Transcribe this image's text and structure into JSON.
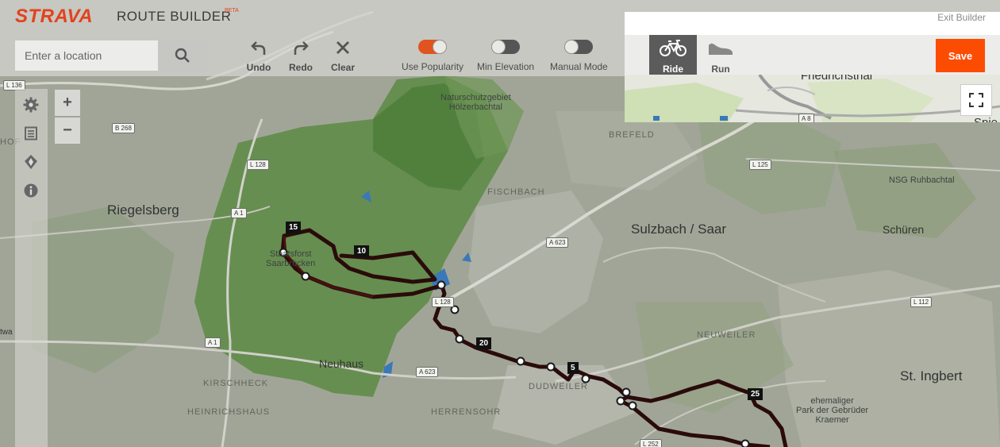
{
  "app": {
    "brand": "STRAVA",
    "title": "ROUTE BUILDER",
    "badge": "BETA"
  },
  "search": {
    "placeholder": "Enter a location",
    "value": ""
  },
  "toolbar": {
    "undo": "Undo",
    "redo": "Redo",
    "clear": "Clear"
  },
  "toggles": {
    "popularity": {
      "label": "Use Popularity",
      "on": true
    },
    "min_elevation": {
      "label": "Min Elevation",
      "on": false
    },
    "manual_mode": {
      "label": "Manual Mode",
      "on": false
    }
  },
  "panel": {
    "exit": "Exit Builder",
    "modes": {
      "ride": "Ride",
      "run": "Run"
    },
    "selected_mode": "ride",
    "save": "Save",
    "minimap_labels": {
      "town": "Friedrichsthal",
      "road": "A 8",
      "edge": "Spie"
    }
  },
  "sidebar_icons": [
    "gear-icon",
    "document-icon",
    "location-pin-icon",
    "info-icon"
  ],
  "zoom": {
    "in": "+",
    "out": "−"
  },
  "map": {
    "towns": {
      "riegelsberg": "Riegelsberg",
      "sulzbach": "Sulzbach / Saar",
      "schuren": "Schüren",
      "neuhaus": "Neuhaus",
      "ingbert": "St. Ingbert"
    },
    "areas": {
      "nsg_holzer": "Naturschutzgebiet\nHölzerbachtal",
      "staatsforst": "Staatsforst\nSaarbrücken",
      "nsg_ruhbachtal": "NSG Ruhbachtal",
      "park": "ehemaliger\nPark der Gebrüder\nKraemer"
    },
    "districts": {
      "brefeld": "BREFELD",
      "fischbach": "FISCHBACH",
      "neuweiler": "NEUWEILER",
      "dudweiler": "DUDWEILER",
      "kirschheck": "KIRSCHHECK",
      "heinrichshaus": "HEINRICHSHAUS",
      "herrensohr": "HERRENSOHR",
      "edge_hof": "HOF",
      "edge_twa": "twa"
    },
    "roads": {
      "l136": "L 136",
      "b268": "B 268",
      "l128a": "L 128",
      "a1a": "A 1",
      "a1b": "A 1",
      "a623a": "A 623",
      "a623b": "A 623",
      "l125": "L 125",
      "l112": "L 112",
      "l252": "L 252",
      "l128b": "L 128"
    },
    "km_markers": {
      "m5": "5",
      "m10": "10",
      "m15": "15",
      "m20": "20",
      "m25": "25"
    }
  },
  "colors": {
    "brand": "#e3421e",
    "save": "#fc4c02",
    "route": "#2a0b0b",
    "toggle_on": "#e0541f",
    "toggle_off": "#555555"
  }
}
